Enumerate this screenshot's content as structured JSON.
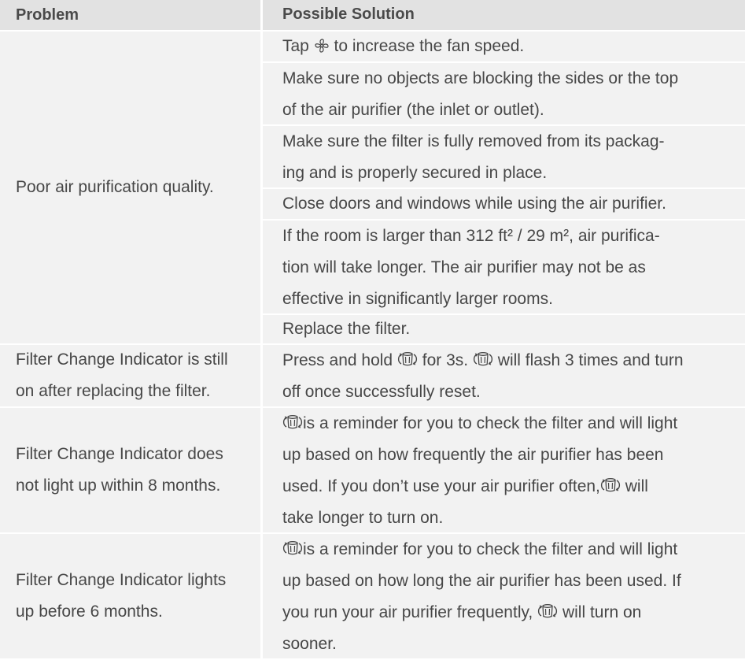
{
  "header": {
    "problem": "Problem",
    "solution": "Possible Solution"
  },
  "rows": [
    {
      "problem": "Poor air purification quality.",
      "solutions": [
        {
          "before": "Tap ",
          "icon": "fan-icon",
          "after": " to increase the fan speed."
        },
        {
          "lines": [
            "Make sure no objects are blocking the sides or the top",
            "of the air purifier (the inlet or outlet)."
          ]
        },
        {
          "lines": [
            "Make sure the filter is fully removed from its packag-",
            "ing and is properly secured in place."
          ]
        },
        {
          "lines": [
            "Close doors and windows while using the air purifier."
          ]
        },
        {
          "lines": [
            "If the room is larger than 312 ft² / 29 m², air purifica-",
            "tion will take longer. The air purifier may not be as",
            "effective in significantly larger rooms."
          ]
        },
        {
          "lines": [
            "Replace the filter."
          ]
        }
      ]
    },
    {
      "problem_lines": [
        "Filter Change Indicator is still",
        "on after replacing the filter."
      ],
      "solution": {
        "l1_a": "Press and hold ",
        "l1_b": " for 3s. ",
        "l1_c": " will flash 3 times and turn",
        "l2": "off once successfully reset.",
        "icon": "filter-change-icon"
      }
    },
    {
      "problem_lines": [
        "Filter Change Indicator does",
        "not light up within 8 months."
      ],
      "solution": {
        "l1": "is a reminder for you to check the filter and will light",
        "l2": "up based on how frequently the air purifier has been",
        "l3_a": "used. If you don’t use your air purifier often,",
        "l3_b": " will",
        "l4": "take longer to turn on.",
        "icon": "filter-change-icon"
      }
    },
    {
      "problem_lines": [
        "Filter Change Indicator lights",
        "up before 6 months."
      ],
      "solution": {
        "l1": "is a reminder for you to check the filter and will light",
        "l2": "up based on how long the air purifier has been used. If",
        "l3_a": "you run your air purifier frequently, ",
        "l3_b": " will turn on",
        "l4": "sooner.",
        "icon": "filter-change-icon"
      }
    }
  ],
  "colors": {
    "header_bg": "#e2e2e2",
    "cell_bg": "#f2f2f2",
    "text": "#474747"
  }
}
